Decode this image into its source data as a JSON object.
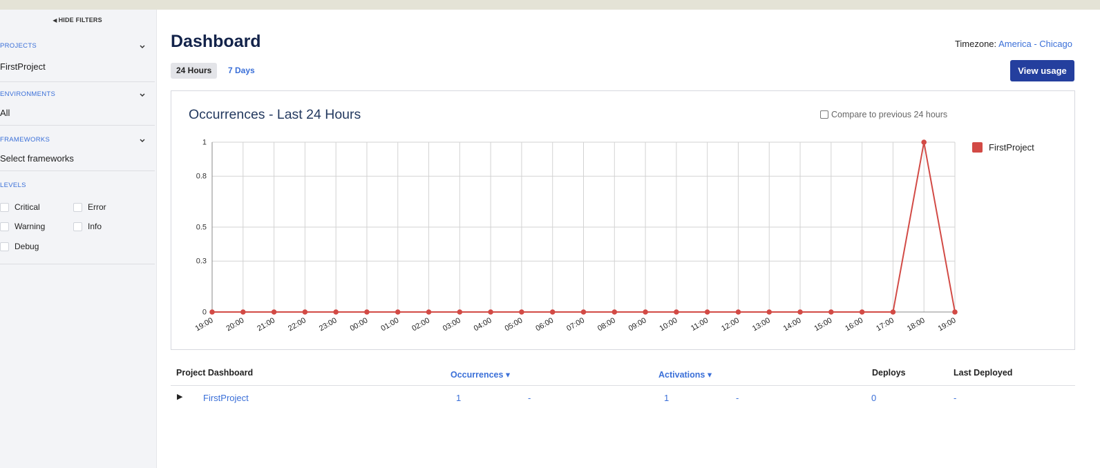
{
  "sidebar": {
    "hide_filters_label": "HIDE FILTERS",
    "projects": {
      "title": "PROJECTS",
      "value": "FirstProject"
    },
    "environments": {
      "title": "ENVIRONMENTS",
      "value": "All"
    },
    "frameworks": {
      "title": "FRAMEWORKS",
      "value": "Select frameworks"
    },
    "levels": {
      "title": "LEVELS",
      "items": [
        {
          "label": "Critical",
          "checked": false
        },
        {
          "label": "Error",
          "checked": false
        },
        {
          "label": "Warning",
          "checked": false
        },
        {
          "label": "Info",
          "checked": false
        },
        {
          "label": "Debug",
          "checked": false
        }
      ]
    }
  },
  "header": {
    "title": "Dashboard",
    "timezone_label": "Timezone:",
    "timezone_value": "America - Chicago",
    "tabs": [
      {
        "label": "24 Hours",
        "active": true
      },
      {
        "label": "7 Days",
        "active": false
      }
    ],
    "view_usage_label": "View usage"
  },
  "chart": {
    "compare_label": "Compare to previous 24 hours",
    "compare_checked": false
  },
  "chart_data": {
    "type": "line",
    "title": "Occurrences - Last 24 Hours",
    "xlabel": "",
    "ylabel": "",
    "x": [
      "19:00",
      "20:00",
      "21:00",
      "22:00",
      "23:00",
      "00:00",
      "01:00",
      "02:00",
      "03:00",
      "04:00",
      "05:00",
      "06:00",
      "07:00",
      "08:00",
      "09:00",
      "10:00",
      "11:00",
      "12:00",
      "13:00",
      "14:00",
      "15:00",
      "16:00",
      "17:00",
      "18:00",
      "19:00"
    ],
    "y_ticks": [
      "0",
      "0.3",
      "0.5",
      "0.8",
      "1"
    ],
    "ylim": [
      0,
      1
    ],
    "grid": true,
    "legend": "right",
    "series": [
      {
        "name": "FirstProject",
        "color": "#d24a45",
        "values": [
          0,
          0,
          0,
          0,
          0,
          0,
          0,
          0,
          0,
          0,
          0,
          0,
          0,
          0,
          0,
          0,
          0,
          0,
          0,
          0,
          0,
          0,
          0,
          1,
          0
        ]
      }
    ]
  },
  "table": {
    "headers": {
      "project": "Project Dashboard",
      "occurrences": "Occurrences ▾",
      "activations": "Activations ▾",
      "deploys": "Deploys",
      "last_deployed": "Last Deployed"
    },
    "rows": [
      {
        "expander": "▶",
        "project": "FirstProject",
        "occurrences": "1",
        "occurrences_change": "-",
        "activations": "1",
        "activations_change": "-",
        "deploys": "0",
        "last_deployed": "-"
      }
    ]
  }
}
